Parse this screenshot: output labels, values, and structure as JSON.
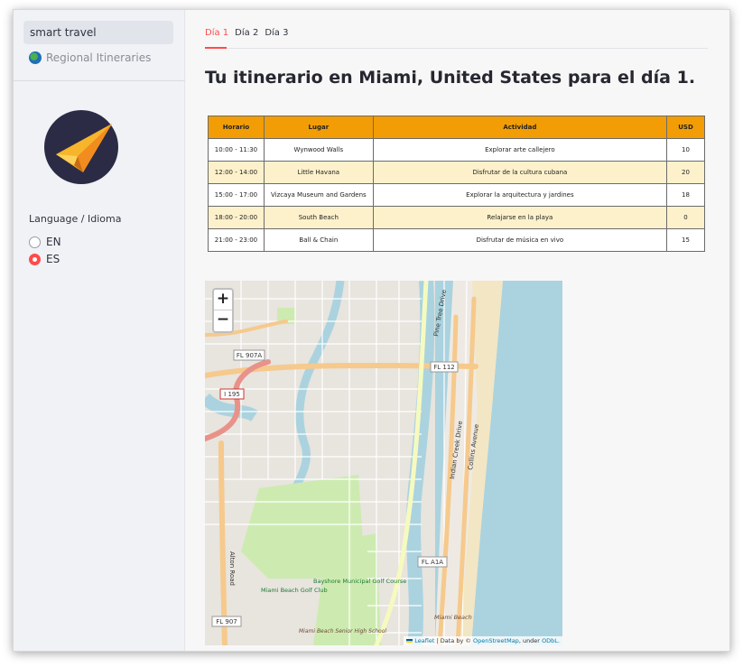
{
  "sidebar": {
    "nav": [
      {
        "label": "smart travel"
      },
      {
        "label": "Regional Itineraries",
        "icon": "globe-icon"
      }
    ],
    "language_label": "Language / Idioma",
    "languages": [
      {
        "label": "EN",
        "selected": false
      },
      {
        "label": "ES",
        "selected": true
      }
    ]
  },
  "main": {
    "tabs": [
      {
        "label": "Día 1",
        "active": true
      },
      {
        "label": "Día 2",
        "active": false
      },
      {
        "label": "Día 3",
        "active": false
      }
    ],
    "title": "Tu itinerario en Miami, United States para el día 1."
  },
  "itinerary": {
    "columns": [
      "Horario",
      "Lugar",
      "Actividad",
      "USD"
    ],
    "rows": [
      [
        "10:00 - 11:30",
        "Wynwood Walls",
        "Explorar arte callejero",
        "10"
      ],
      [
        "12:00 - 14:00",
        "Little Havana",
        "Disfrutar de la cultura cubana",
        "20"
      ],
      [
        "15:00 - 17:00",
        "Vizcaya Museum and Gardens",
        "Explorar la arquitectura y jardines",
        "18"
      ],
      [
        "18:00 - 20:00",
        "South Beach",
        "Relajarse en la playa",
        "0"
      ],
      [
        "21:00 - 23:00",
        "Ball & Chain",
        "Disfrutar de música en vivo",
        "15"
      ]
    ]
  },
  "map": {
    "zoom_in": "+",
    "zoom_out": "−",
    "labels": {
      "road_fl907a": "FL 907A",
      "road_i195": "I 195",
      "road_fl112": "FL 112",
      "road_fla1a": "FL A1A",
      "road_fl907": "FL 907",
      "alton_road": "Alton Road",
      "pine_tree_drive": "Pine Tree Drive",
      "indian_creek_drive": "Indian Creek Drive",
      "collins_avenue": "Collins Avenue",
      "golf_miami_beach": "Miami Beach Golf Club",
      "golf_bayshore": "Bayshore Municipal Golf Course",
      "school": "Miami Beach Senior High School",
      "miami_beach": "Miami Beach"
    },
    "attribution": {
      "leaflet": "Leaflet",
      "data_by": "| Data by ©",
      "osm": "OpenStreetMap",
      "under": ", under",
      "odbl": "ODbL."
    }
  },
  "colors": {
    "accent": "#ff4b4b",
    "table_header": "#f29d05",
    "table_alt_row": "#fdf1cb",
    "water": "#aad3df",
    "park": "#cdebb0",
    "major_road": "#f6c98c"
  }
}
